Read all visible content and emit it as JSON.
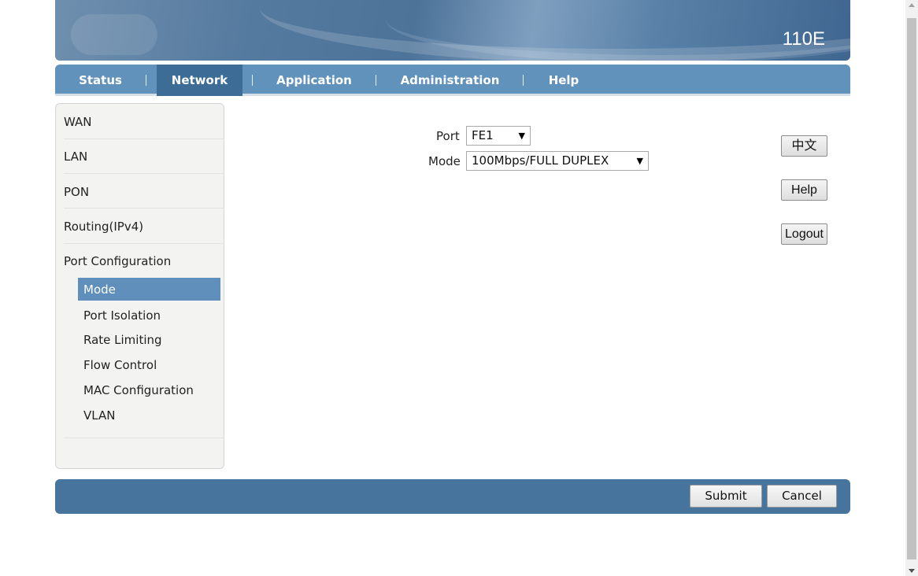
{
  "banner": {
    "model": "110E"
  },
  "nav": {
    "items": [
      {
        "label": "Status"
      },
      {
        "label": "Network",
        "active": true
      },
      {
        "label": "Application"
      },
      {
        "label": "Administration"
      },
      {
        "label": "Help"
      }
    ]
  },
  "sidebar": {
    "items": [
      {
        "label": "WAN"
      },
      {
        "label": "LAN"
      },
      {
        "label": "PON"
      },
      {
        "label": "Routing(IPv4)"
      },
      {
        "label": "Port Configuration"
      }
    ],
    "subitems": [
      {
        "label": "Mode",
        "active": true
      },
      {
        "label": "Port Isolation"
      },
      {
        "label": "Rate Limiting"
      },
      {
        "label": "Flow Control"
      },
      {
        "label": "MAC Configuration"
      },
      {
        "label": "VLAN"
      }
    ]
  },
  "form": {
    "port_label": "Port",
    "port_value": "FE1",
    "mode_label": "Mode",
    "mode_value": "100Mbps/FULL DUPLEX"
  },
  "side_buttons": {
    "language": "中文",
    "help": "Help",
    "logout": "Logout"
  },
  "footer": {
    "submit": "Submit",
    "cancel": "Cancel"
  },
  "icons": {
    "select_arrow": "▼"
  },
  "colors": {
    "nav_bg": "#6192bc",
    "nav_active": "#3d6c96",
    "sidebar_active": "#5f8fba",
    "footer_bg": "#46749c"
  }
}
